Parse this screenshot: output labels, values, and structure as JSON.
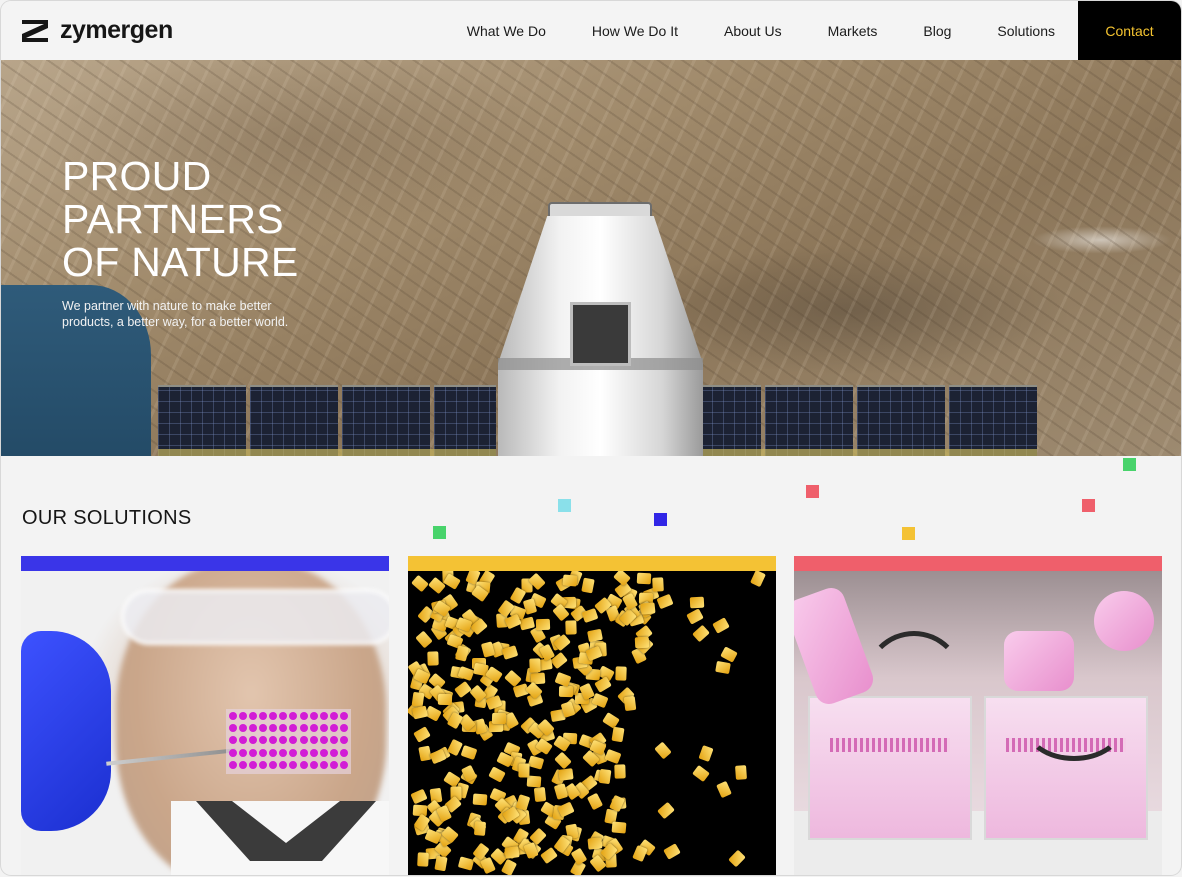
{
  "brand": {
    "logo_icon": "zymergen-z-icon",
    "name": "zymergen"
  },
  "nav": {
    "items": [
      "What We Do",
      "How We Do It",
      "About Us",
      "Markets",
      "Blog",
      "Solutions"
    ],
    "contact": "Contact"
  },
  "hero": {
    "title": "PROUD\nPARTNERS\nOF NATURE",
    "subtitle": "We partner with nature to make better products, a better way, for a better world."
  },
  "solutions": {
    "title": "OUR SOLUTIONS",
    "cards": [
      {
        "accent": "#3a35e8"
      },
      {
        "accent": "#f4c234"
      },
      {
        "accent": "#ef5f6b"
      }
    ]
  },
  "colors": {
    "contact_bg": "#000000",
    "contact_text": "#f5c430",
    "decor_green": "#48d36b",
    "decor_cyan": "#8ae0ea",
    "decor_blue": "#3126e6",
    "decor_red": "#ef5f6b",
    "decor_yellow": "#f4c234"
  }
}
